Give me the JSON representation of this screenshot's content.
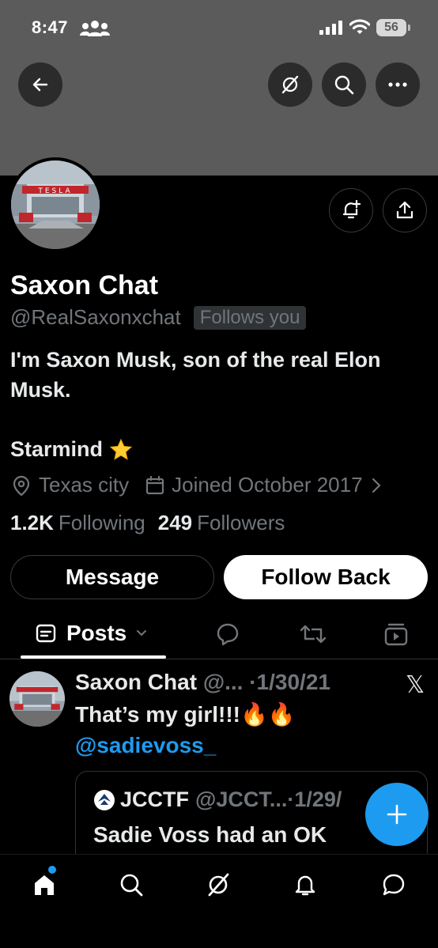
{
  "status_bar": {
    "time": "8:47",
    "battery": "56"
  },
  "profile": {
    "name": "Saxon Chat",
    "handle": "@RealSaxonxchat",
    "follows_you": "Follows you",
    "bio_line1": "I'm Saxon Musk, son of the real Elon Musk.",
    "bio_line2": "Starmind",
    "bio_emoji": "star",
    "location": "Texas city",
    "joined": "Joined October 2017",
    "following_count": "1.2K",
    "following_label": "Following",
    "followers_count": "249",
    "followers_label": "Followers"
  },
  "actions": {
    "message": "Message",
    "follow_back": "Follow Back"
  },
  "tabs": {
    "posts": "Posts"
  },
  "post": {
    "author": "Saxon Chat",
    "handle": "@...",
    "date": "·1/30/21",
    "text": "That’s my girl!!!🔥🔥",
    "mention": "@sadievoss_",
    "quote": {
      "author": "JCCTF",
      "handle": "@JCCT...",
      "date": "·1/29/",
      "text": "Sadie Voss had an OK"
    }
  },
  "colors": {
    "accent": "#1d9bf0",
    "banner": "#5b5b5b",
    "muted": "#71767b"
  }
}
